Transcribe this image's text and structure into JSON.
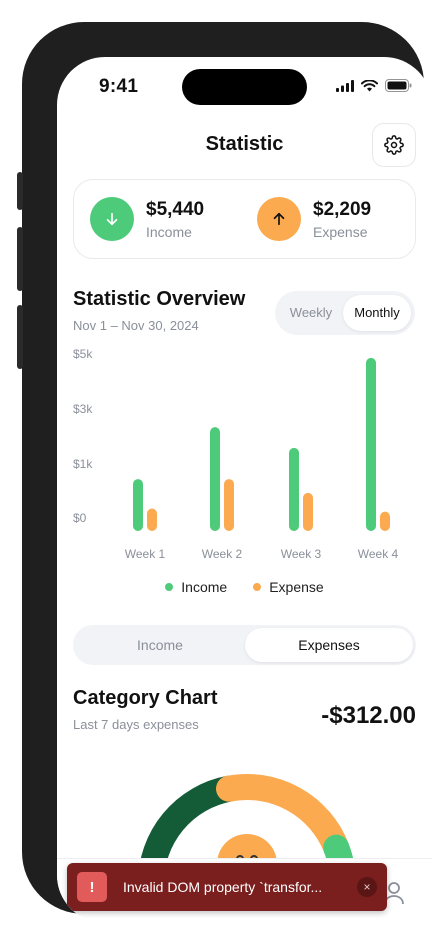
{
  "status_bar": {
    "time": "9:41"
  },
  "header": {
    "title": "Statistic"
  },
  "summary": {
    "income": {
      "amount": "$5,440",
      "label": "Income",
      "color": "#4ecb7a"
    },
    "expense": {
      "amount": "$2,209",
      "label": "Expense",
      "color": "#fbaa4f"
    }
  },
  "overview": {
    "title": "Statistic Overview",
    "range": "Nov 1 – Nov 30, 2024",
    "toggle": {
      "weekly": "Weekly",
      "monthly": "Monthly",
      "selected": "Monthly"
    }
  },
  "chart_data": {
    "type": "bar",
    "categories": [
      "Week 1",
      "Week 2",
      "Week 3",
      "Week 4"
    ],
    "y_tick_labels": [
      "$5k",
      "$3k",
      "$1k",
      "$0"
    ],
    "y_tick_values": [
      5000,
      3000,
      1000,
      0
    ],
    "ylim": [
      0,
      5200
    ],
    "grid": false,
    "legend_placement": "bottom-center",
    "series": [
      {
        "name": "Income",
        "values": [
          1500,
          3000,
          2400,
          5000
        ],
        "color": "#4ecb7a"
      },
      {
        "name": "Expense",
        "values": [
          650,
          1500,
          1100,
          560
        ],
        "color": "#fbaa4f"
      }
    ]
  },
  "tabs": {
    "income": "Income",
    "expenses": "Expenses",
    "selected": "Expenses"
  },
  "category": {
    "title": "Category Chart",
    "subtitle": "Last 7 days expenses",
    "total": "-$312.00",
    "segments": [
      {
        "fraction": 0.44,
        "color": "#145c37"
      },
      {
        "fraction": 0.44,
        "color": "#fbaa4f"
      },
      {
        "fraction": 0.12,
        "color": "#4ecb7a"
      }
    ]
  },
  "toast": {
    "message": "Invalid DOM property `transfor...",
    "badge": "!",
    "close": "×"
  }
}
